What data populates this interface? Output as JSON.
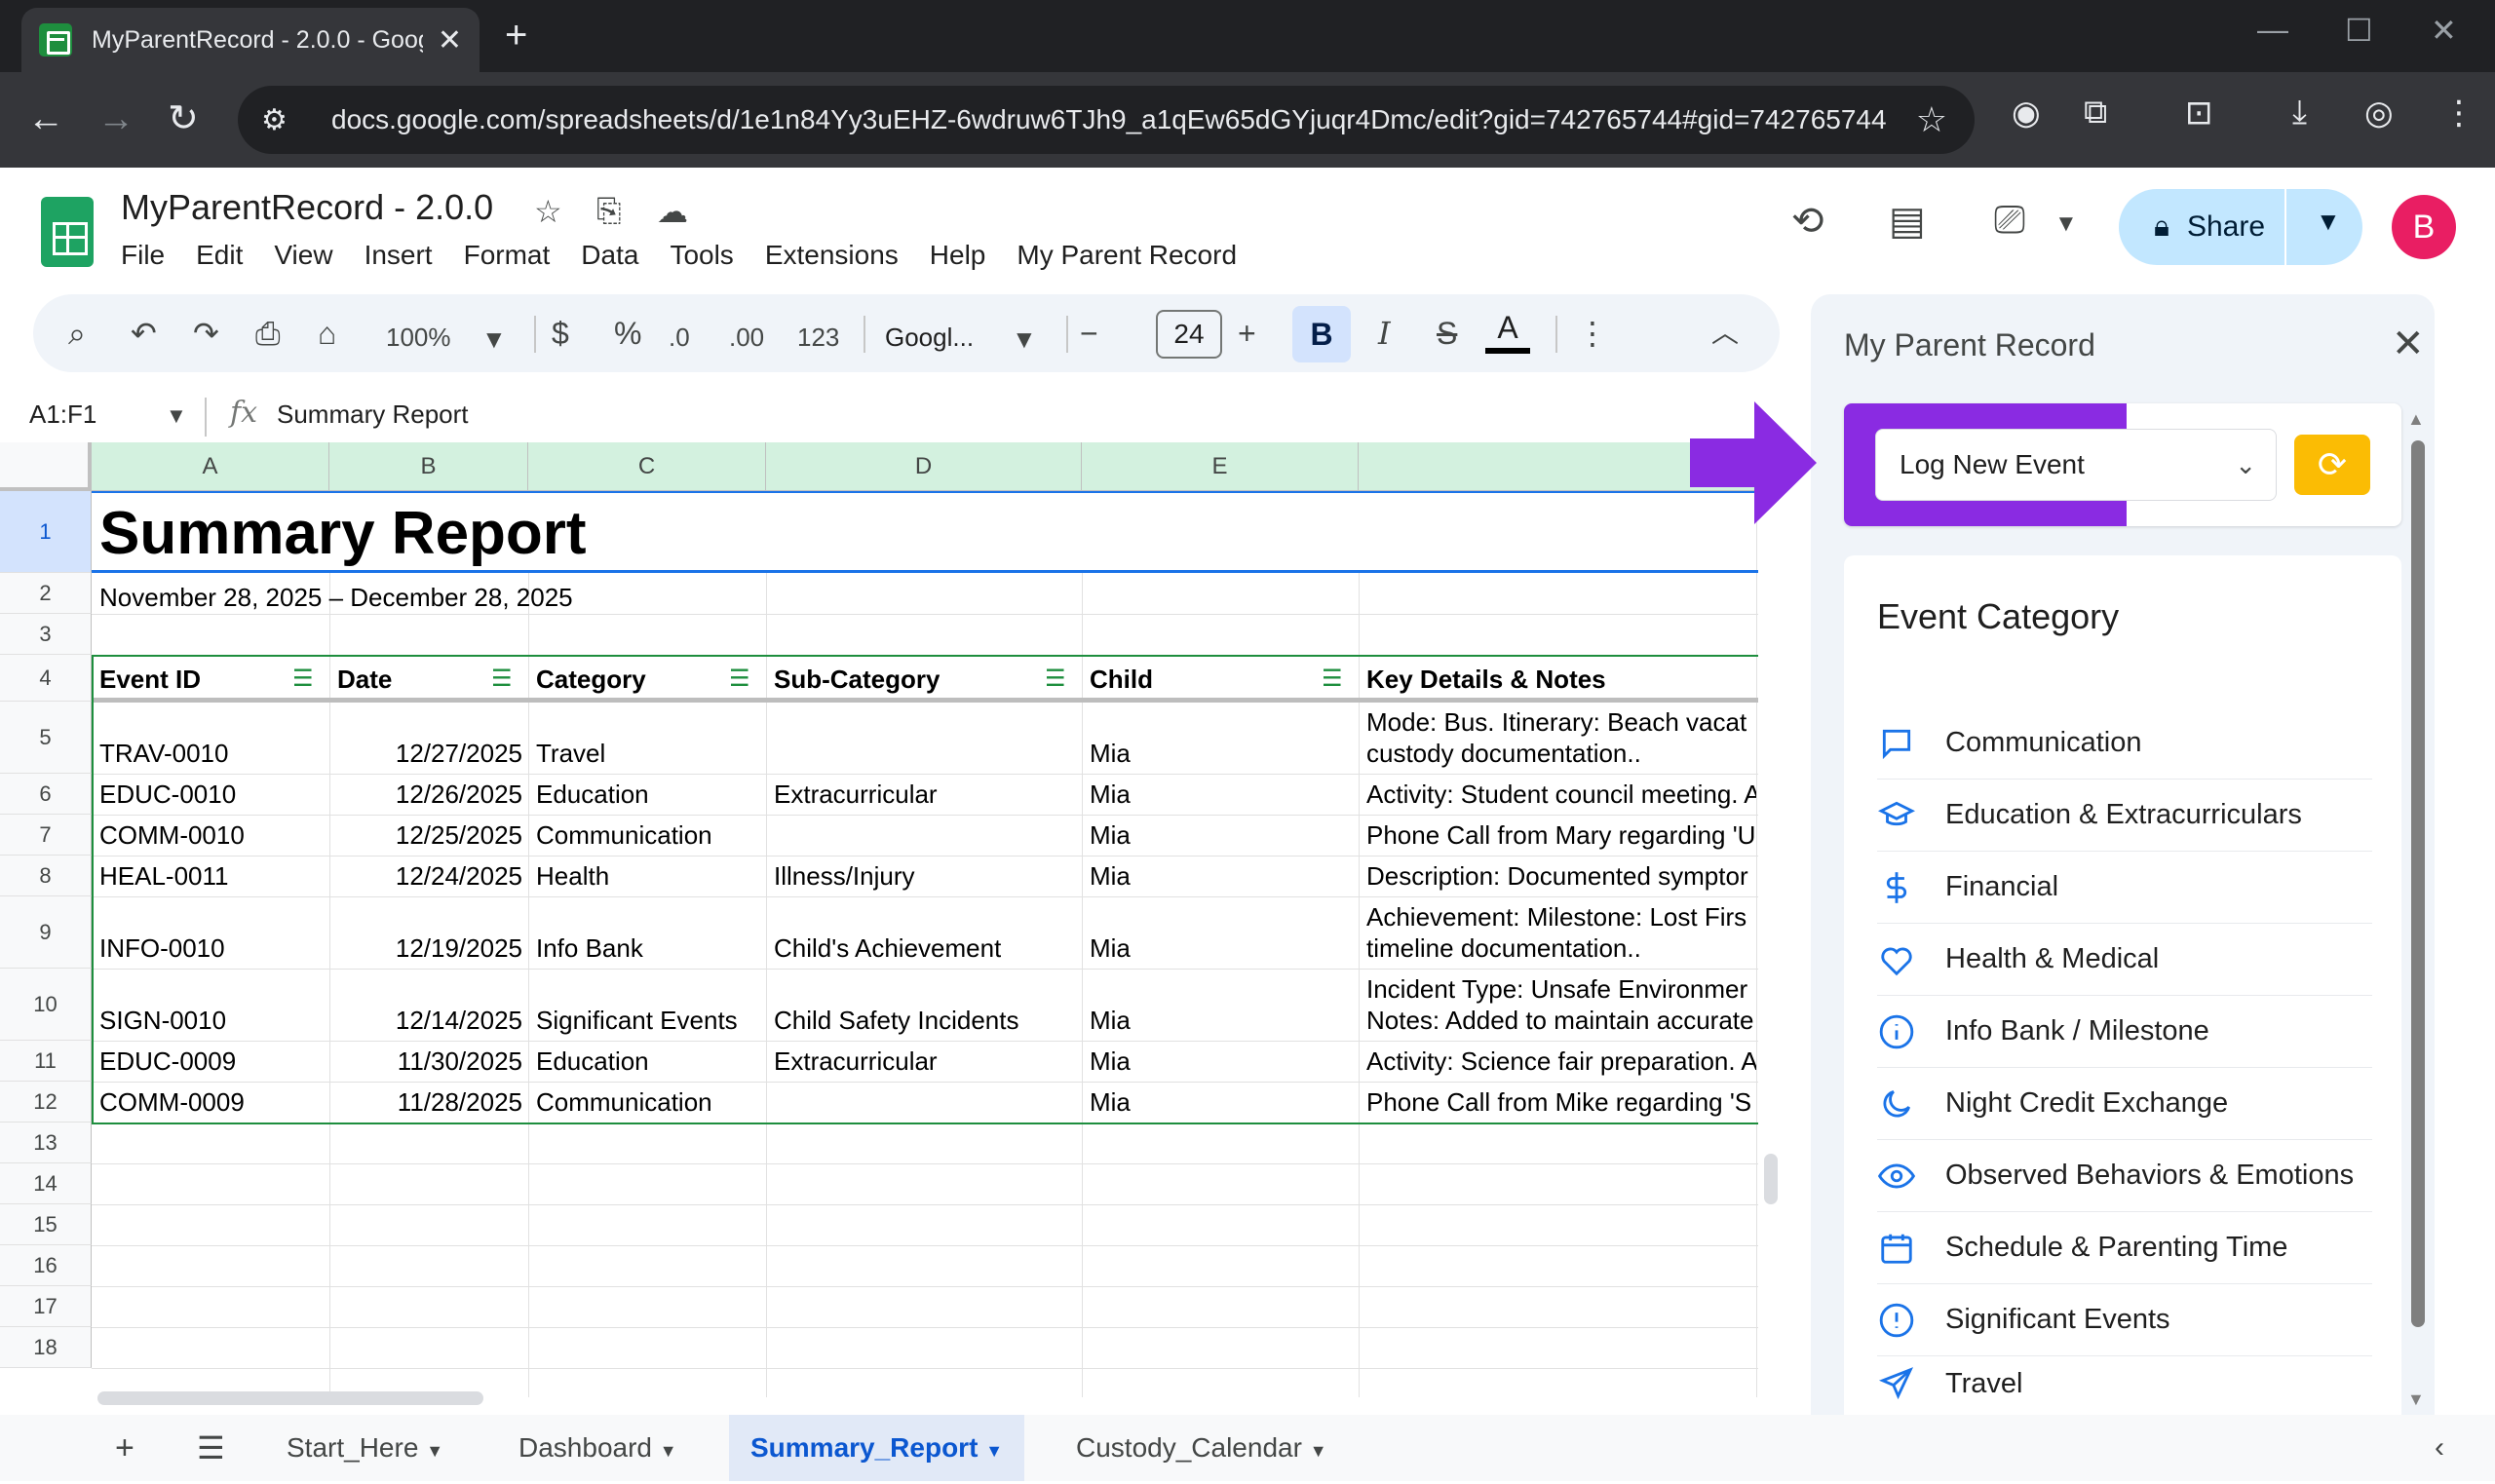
{
  "browser": {
    "tab_title": "MyParentRecord - 2.0.0 - Googl",
    "url": "docs.google.com/spreadsheets/d/1e1n84Yy3uEHZ-6wdruw6TJh9_a1qEw65dGYjuqr4Dmc/edit?gid=742765744#gid=742765744"
  },
  "doc": {
    "title": "MyParentRecord - 2.0.0",
    "menu": [
      "File",
      "Edit",
      "View",
      "Insert",
      "Format",
      "Data",
      "Tools",
      "Extensions",
      "Help",
      "My Parent Record"
    ],
    "share_label": "Share",
    "avatar_letter": "B"
  },
  "toolbar": {
    "zoom": "100%",
    "currency": "$",
    "percent": "%",
    "dec_decrease": ".0",
    "dec_increase": ".00",
    "format_123": "123",
    "font": "Googl...",
    "font_size": "24",
    "bold": "B",
    "italic": "I",
    "strike": "S",
    "text_color": "A"
  },
  "formula_bar": {
    "range": "A1:F1",
    "fx": "fx",
    "content": "Summary Report"
  },
  "grid": {
    "columns": [
      "A",
      "B",
      "C",
      "D",
      "E",
      ""
    ],
    "rows": [
      "1",
      "2",
      "3",
      "4",
      "5",
      "6",
      "7",
      "8",
      "9",
      "10",
      "11",
      "12",
      "13",
      "14",
      "15",
      "16",
      "17",
      "18"
    ],
    "title": "Summary Report",
    "date_range": "November 28, 2025 – December 28, 2025",
    "headers": [
      "Event ID",
      "Date",
      "Category",
      "Sub-Category",
      "Child",
      "Key Details & Notes"
    ],
    "data": [
      {
        "id": "TRAV-0010",
        "date": "12/27/2025",
        "category": "Travel",
        "sub": "",
        "child": "Mia",
        "notes1": "Mode: Bus. Itinerary: Beach vacat",
        "notes2": "custody documentation.."
      },
      {
        "id": "EDUC-0010",
        "date": "12/26/2025",
        "category": "Education",
        "sub": "Extracurricular",
        "child": "Mia",
        "notes1": "Activity: Student council meeting. A",
        "notes2": ""
      },
      {
        "id": "COMM-0010",
        "date": "12/25/2025",
        "category": "Communication",
        "sub": "",
        "child": "Mia",
        "notes1": "Phone Call from Mary regarding 'U",
        "notes2": ""
      },
      {
        "id": "HEAL-0011",
        "date": "12/24/2025",
        "category": "Health",
        "sub": "Illness/Injury",
        "child": "Mia",
        "notes1": "Description: Documented symptor",
        "notes2": ""
      },
      {
        "id": "INFO-0010",
        "date": "12/19/2025",
        "category": "Info Bank",
        "sub": "Child's Achievement",
        "child": "Mia",
        "notes1": "Achievement: Milestone: Lost Firs",
        "notes2": "timeline documentation.."
      },
      {
        "id": "SIGN-0010",
        "date": "12/14/2025",
        "category": "Significant Events",
        "sub": "Child Safety Incidents",
        "child": "Mia",
        "notes1": "Incident Type: Unsafe Environmer",
        "notes2": "Notes: Added to maintain accurate"
      },
      {
        "id": "EDUC-0009",
        "date": "11/30/2025",
        "category": "Education",
        "sub": "Extracurricular",
        "child": "Mia",
        "notes1": "Activity: Science fair preparation. A",
        "notes2": ""
      },
      {
        "id": "COMM-0009",
        "date": "11/28/2025",
        "category": "Communication",
        "sub": "",
        "child": "Mia",
        "notes1": "Phone Call from Mike regarding 'S",
        "notes2": ""
      }
    ]
  },
  "sheet_tabs": [
    "Start_Here",
    "Dashboard",
    "Summary_Report",
    "Custody_Calendar"
  ],
  "active_sheet": "Summary_Report",
  "panel": {
    "title": "My Parent Record",
    "log_select": "Log New Event",
    "category_heading": "Event Category",
    "categories": [
      {
        "label": "Communication",
        "icon": "chat-icon"
      },
      {
        "label": "Education & Extracurriculars",
        "icon": "graduation-cap-icon"
      },
      {
        "label": "Financial",
        "icon": "dollar-icon"
      },
      {
        "label": "Health & Medical",
        "icon": "heart-icon"
      },
      {
        "label": "Info Bank / Milestone",
        "icon": "info-icon"
      },
      {
        "label": "Night Credit Exchange",
        "icon": "moon-icon"
      },
      {
        "label": "Observed Behaviors & Emotions",
        "icon": "eye-icon"
      },
      {
        "label": "Schedule & Parenting Time",
        "icon": "calendar-icon"
      },
      {
        "label": "Significant Events",
        "icon": "alert-icon"
      },
      {
        "label": "Travel",
        "icon": "plane-icon"
      }
    ]
  },
  "colors": {
    "accent_blue": "#1a73e8",
    "sheets_green": "#1e8e3e",
    "header_green": "#d3f1df",
    "purple": "#8a2be2",
    "refresh_yellow": "#fbbc04",
    "avatar_pink": "#e91e63"
  }
}
